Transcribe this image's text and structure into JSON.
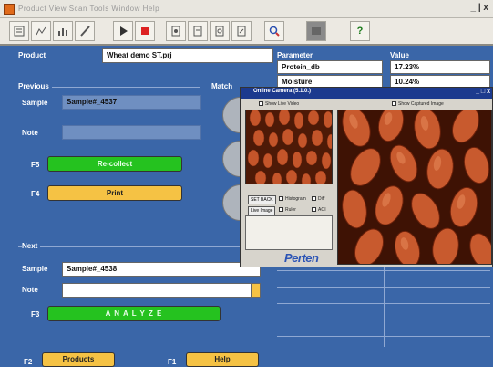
{
  "window": {
    "menu": "Product   View   Scan   Tools   Window   Help",
    "controls": "_ | x"
  },
  "toolbar": {
    "icons": [
      "list-icon",
      "chart-icon",
      "bar-chart-icon",
      "pencil-icon",
      "play-icon",
      "stop-icon",
      "doc-a-icon",
      "doc-b-icon",
      "doc-c-icon",
      "doc-d-icon",
      "search-icon",
      "db-icon",
      "help-icon"
    ],
    "help_label": "?"
  },
  "product": {
    "header": "Product",
    "value": "Wheat demo ST.prj"
  },
  "parameters": {
    "header_param": "Parameter",
    "header_value": "Value",
    "rows": [
      {
        "name": "Protein_db",
        "value": "17.23%"
      },
      {
        "name": "Moisture",
        "value": "10.24%"
      }
    ]
  },
  "previous": {
    "header": "Previous",
    "match_header": "Match",
    "sample_label": "Sample",
    "sample_value": "Sample#_4537",
    "note_label": "Note",
    "note_value": "",
    "f5": "F5",
    "recollect": "Re-collect",
    "f4": "F4",
    "print": "Print"
  },
  "next": {
    "header": "Next",
    "sample_label": "Sample",
    "sample_value": "Sample#_4538",
    "note_label": "Note",
    "note_value": "",
    "f3": "F3",
    "analyze": "A N A L Y Z E"
  },
  "footer": {
    "f2": "F2",
    "products": "Products",
    "f1": "F1",
    "help": "Help"
  },
  "camera": {
    "title": "Online Camera (5.1.0.)",
    "controls": "_ □ x",
    "show_live": "Show Live Video",
    "show_captured": "Show Captured Image",
    "set_back": "SET BACK",
    "histogram": "Histogram",
    "diff": "Diff",
    "live_image": "Live Image",
    "ruler": "Ruler",
    "aoi": "AOI",
    "brand": "Perten"
  },
  "colors": {
    "background": "#3a66a8",
    "green_button": "#25c21f",
    "yellow_button": "#f5c244"
  }
}
